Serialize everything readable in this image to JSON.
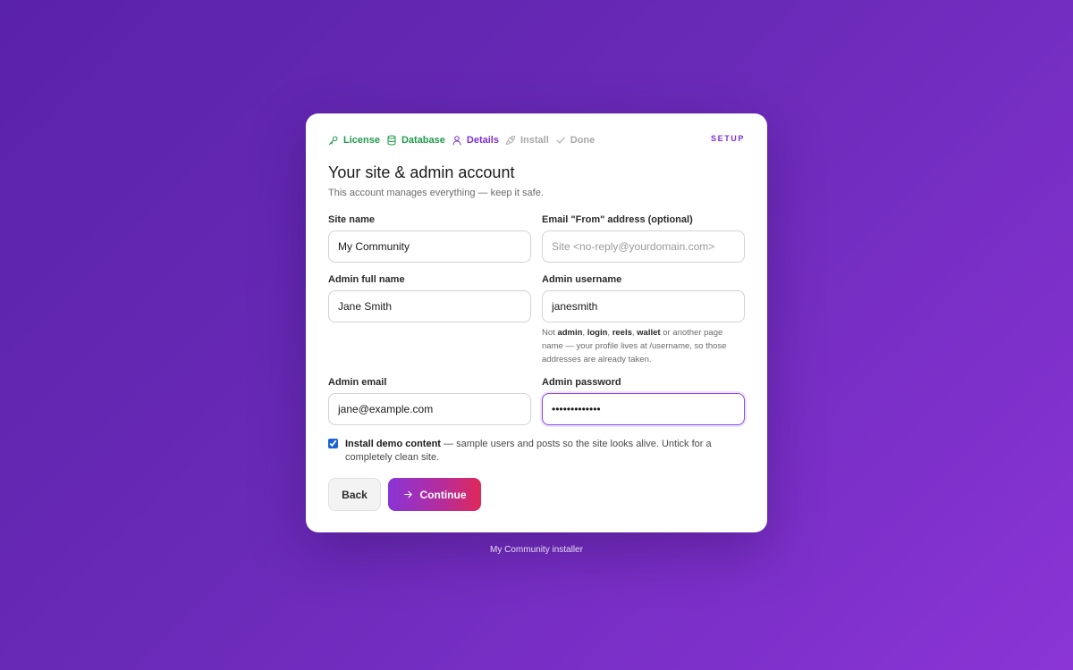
{
  "stepper": {
    "steps": [
      {
        "label": "License",
        "state": "done",
        "icon": "key-icon"
      },
      {
        "label": "Database",
        "state": "done",
        "icon": "database-icon"
      },
      {
        "label": "Details",
        "state": "current",
        "icon": "user-icon"
      },
      {
        "label": "Install",
        "state": "pending",
        "icon": "rocket-icon"
      },
      {
        "label": "Done",
        "state": "pending",
        "icon": "check-icon"
      }
    ],
    "setup_label": "SETUP"
  },
  "header": {
    "title": "Your site & admin account",
    "subtitle": "This account manages everything — keep it safe."
  },
  "form": {
    "site_name": {
      "label": "Site name",
      "value": "My Community"
    },
    "email_from": {
      "label": "Email \"From\" address (optional)",
      "value": "",
      "placeholder": "Site <no-reply@yourdomain.com>"
    },
    "admin_full_name": {
      "label": "Admin full name",
      "value": "Jane Smith"
    },
    "admin_username": {
      "label": "Admin username",
      "value": "janesmith",
      "hint": {
        "prefix": "Not ",
        "reserved": [
          "admin",
          "login",
          "reels",
          "wallet"
        ],
        "sep": ", ",
        "suffix": " or another page name — your profile lives at /username, so those addresses are already taken."
      }
    },
    "admin_email": {
      "label": "Admin email",
      "value": "jane@example.com"
    },
    "admin_password": {
      "label": "Admin password",
      "value": "•••••••••••••"
    }
  },
  "demo": {
    "checked": true,
    "bold": "Install demo content",
    "rest": " — sample users and posts so the site looks alive. Untick for a completely clean site."
  },
  "actions": {
    "back_label": "Back",
    "continue_label": "Continue"
  },
  "footer": "My Community installer",
  "colors": {
    "done": "#1f9a4a",
    "current": "#7b2fd0",
    "pending": "#a8a8a8",
    "accent": "#8a4be0"
  }
}
